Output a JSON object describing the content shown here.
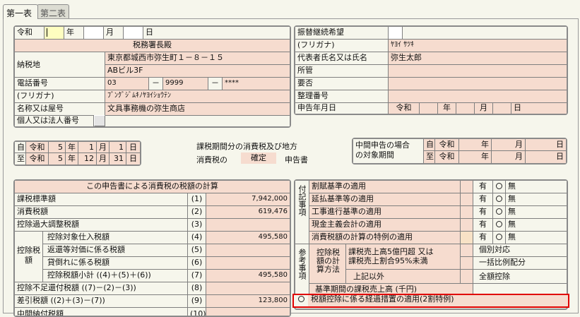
{
  "tabs": {
    "first": "第一表",
    "second": "第二表"
  },
  "date": {
    "era": "令和",
    "year": "年",
    "month": "月",
    "day": "日"
  },
  "office": "税務署長殿",
  "taxplace": {
    "label": "納税地",
    "addr1": "東京都城西市弥生町１－８－１５",
    "addr2": "ABビル3F"
  },
  "phone": {
    "label": "電話番号",
    "p1": "03",
    "dash": "－",
    "p2": "9999",
    "p3": "****"
  },
  "furigana": {
    "label": "(フリガナ)",
    "value": "ﾌﾞﾝｸﾞｼﾞﾑｷﾉﾔﾖｲｼｮｳﾃﾝ"
  },
  "name": {
    "label": "名称又は屋号",
    "value": "文具事務機の弥生商店"
  },
  "corp": {
    "label": "個人又は法人番号"
  },
  "right": {
    "transfer": "振替継続希望",
    "furigana_label": "(フリガナ)",
    "furigana_value": "ﾔﾖｲ ｻﾂｷ",
    "rep_label": "代表者氏名又は氏名",
    "rep_value": "弥生太郎",
    "office": "所管",
    "need": "要否",
    "num": "整理番号",
    "date": "申告年月日",
    "era": "令和",
    "year": "年",
    "month": "月",
    "day": "日"
  },
  "period": {
    "from": "自",
    "to": "至",
    "era": "令和",
    "from_y": "5",
    "from_m": "1",
    "from_d": "1",
    "to_y": "5",
    "to_m": "12",
    "to_d": "31",
    "y": "年",
    "m": "月",
    "d": "日",
    "t1": "課税期間分の消費税及び地方",
    "t2": "消費税の",
    "t3": "確定",
    "t4": "申告書"
  },
  "interim": {
    "l1": "中間申告の場合",
    "l2": "の対象期間",
    "from": "自",
    "to": "至",
    "era": "令和",
    "y": "年",
    "m": "月",
    "d": "日"
  },
  "calc": {
    "title": "この申告書による消費税の税額の計算",
    "group": "控除税額",
    "rows": [
      {
        "label": "課税標準額",
        "no": "(1)",
        "value": "7,942,000"
      },
      {
        "label": "消費税額",
        "no": "(2)",
        "value": "619,476"
      },
      {
        "label": "控除過大調整税額",
        "no": "(3)",
        "value": ""
      },
      {
        "label": "控除対象仕入税額",
        "no": "(4)",
        "value": "495,580"
      },
      {
        "label": "返還等対価に係る税額",
        "no": "(5)",
        "value": ""
      },
      {
        "label": "貸倒れに係る税額",
        "no": "(6)",
        "value": ""
      },
      {
        "label": "控除税額小計 ((4)＋(5)＋(6))",
        "no": "(7)",
        "value": "495,580"
      },
      {
        "label": "控除不足還付税額 ((7)－(2)－(3))",
        "no": "(8)",
        "value": ""
      },
      {
        "label": "差引税額 ((2)＋(3)－(7))",
        "no": "(9)",
        "value": "123,800"
      },
      {
        "label": "中間納付税額",
        "no": "(10)",
        "value": ""
      }
    ]
  },
  "notes": {
    "group1": "付記事項",
    "group2": "参考事項",
    "items": [
      {
        "label": "割賦基準の適用",
        "yes": "有",
        "no": "無"
      },
      {
        "label": "延払基準等の適用",
        "yes": "有",
        "no": "無"
      },
      {
        "label": "工事進行基準の適用",
        "yes": "有",
        "no": "無"
      },
      {
        "label": "現金主義会計の適用",
        "yes": "有",
        "no": "無"
      },
      {
        "label": "消費税額の計算の特例の適用",
        "yes": "有",
        "no": "無"
      }
    ],
    "deduct_method": "控除税額の計算方法",
    "m1a": "課税売上高5億円超 又は",
    "m1b": "課税売上割合95%未満",
    "opt1": "個別対応",
    "opt2": "一括比例配分",
    "m2": "上記以外",
    "opt3": "全額控除",
    "base": "基準期間の課税売上高 (千円)",
    "special": "税額控除に係る経過措置の適用(2割特例)"
  }
}
